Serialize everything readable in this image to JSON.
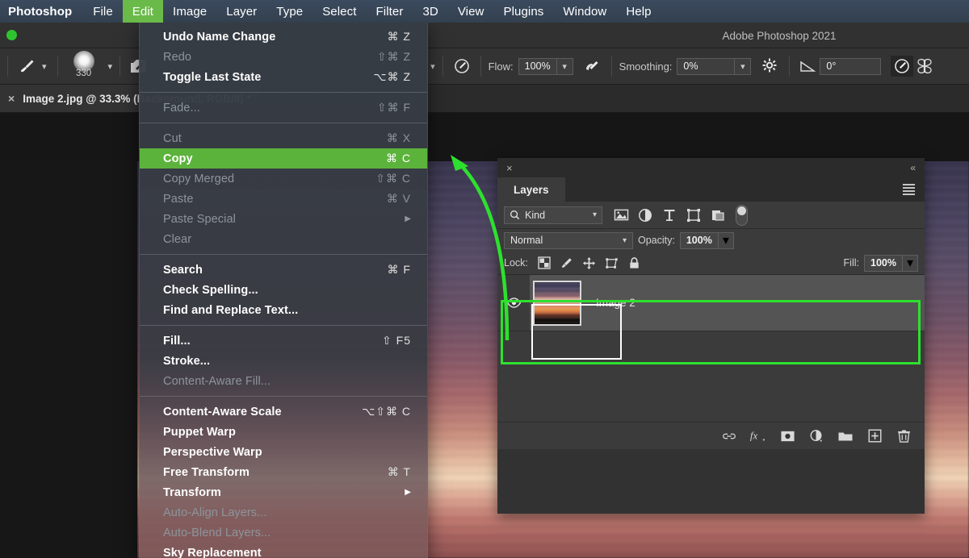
{
  "app": {
    "window_title": "Adobe Photoshop 2021",
    "accent_green": "#5cb33c",
    "annotation_green": "#2ee02e"
  },
  "menubar": {
    "items": [
      {
        "label": "Photoshop",
        "active": false,
        "bold": true
      },
      {
        "label": "File",
        "active": false
      },
      {
        "label": "Edit",
        "active": true
      },
      {
        "label": "Image",
        "active": false
      },
      {
        "label": "Layer",
        "active": false
      },
      {
        "label": "Type",
        "active": false
      },
      {
        "label": "Select",
        "active": false
      },
      {
        "label": "Filter",
        "active": false
      },
      {
        "label": "3D",
        "active": false
      },
      {
        "label": "View",
        "active": false
      },
      {
        "label": "Plugins",
        "active": false
      },
      {
        "label": "Window",
        "active": false
      },
      {
        "label": "Help",
        "active": false
      }
    ]
  },
  "toolbar": {
    "brush_size": "330",
    "flow_label": "Flow:",
    "flow_value": "100%",
    "smoothing_label": "Smoothing:",
    "smoothing_value": "0%",
    "angle_value": "0°"
  },
  "document_tab": {
    "title": "Image 2.jpg @ 33.3% (Background, RGB/8) *",
    "close_glyph": "×"
  },
  "edit_menu": {
    "groups": [
      {
        "items": [
          {
            "label": "Undo Name Change",
            "shortcut": "⌘ Z",
            "disabled": false,
            "highlight": false,
            "submenu": false
          },
          {
            "label": "Redo",
            "shortcut": "⇧⌘ Z",
            "disabled": true,
            "highlight": false,
            "submenu": false
          },
          {
            "label": "Toggle Last State",
            "shortcut": "⌥⌘ Z",
            "disabled": false,
            "highlight": false,
            "submenu": false
          }
        ]
      },
      {
        "items": [
          {
            "label": "Fade...",
            "shortcut": "⇧⌘ F",
            "disabled": true,
            "highlight": false,
            "submenu": false
          }
        ]
      },
      {
        "items": [
          {
            "label": "Cut",
            "shortcut": "⌘ X",
            "disabled": true,
            "highlight": false,
            "submenu": false
          },
          {
            "label": "Copy",
            "shortcut": "⌘ C",
            "disabled": false,
            "highlight": true,
            "submenu": false
          },
          {
            "label": "Copy Merged",
            "shortcut": "⇧⌘ C",
            "disabled": true,
            "highlight": false,
            "submenu": false
          },
          {
            "label": "Paste",
            "shortcut": "⌘ V",
            "disabled": true,
            "highlight": false,
            "submenu": false
          },
          {
            "label": "Paste Special",
            "shortcut": "",
            "disabled": true,
            "highlight": false,
            "submenu": true
          },
          {
            "label": "Clear",
            "shortcut": "",
            "disabled": true,
            "highlight": false,
            "submenu": false
          }
        ]
      },
      {
        "items": [
          {
            "label": "Search",
            "shortcut": "⌘ F",
            "disabled": false,
            "highlight": false,
            "submenu": false
          },
          {
            "label": "Check Spelling...",
            "shortcut": "",
            "disabled": false,
            "highlight": false,
            "submenu": false
          },
          {
            "label": "Find and Replace Text...",
            "shortcut": "",
            "disabled": false,
            "highlight": false,
            "submenu": false
          }
        ]
      },
      {
        "items": [
          {
            "label": "Fill...",
            "shortcut": "⇧ F5",
            "disabled": false,
            "highlight": false,
            "submenu": false
          },
          {
            "label": "Stroke...",
            "shortcut": "",
            "disabled": false,
            "highlight": false,
            "submenu": false
          },
          {
            "label": "Content-Aware Fill...",
            "shortcut": "",
            "disabled": true,
            "highlight": false,
            "submenu": false
          }
        ]
      },
      {
        "items": [
          {
            "label": "Content-Aware Scale",
            "shortcut": "⌥⇧⌘ C",
            "disabled": false,
            "highlight": false,
            "submenu": false
          },
          {
            "label": "Puppet Warp",
            "shortcut": "",
            "disabled": false,
            "highlight": false,
            "submenu": false
          },
          {
            "label": "Perspective Warp",
            "shortcut": "",
            "disabled": false,
            "highlight": false,
            "submenu": false
          },
          {
            "label": "Free Transform",
            "shortcut": "⌘ T",
            "disabled": false,
            "highlight": false,
            "submenu": false
          },
          {
            "label": "Transform",
            "shortcut": "",
            "disabled": false,
            "highlight": false,
            "submenu": true
          },
          {
            "label": "Auto-Align Layers...",
            "shortcut": "",
            "disabled": true,
            "highlight": false,
            "submenu": false
          },
          {
            "label": "Auto-Blend Layers...",
            "shortcut": "",
            "disabled": true,
            "highlight": false,
            "submenu": false
          },
          {
            "label": "Sky Replacement",
            "shortcut": "",
            "disabled": false,
            "highlight": false,
            "submenu": false
          }
        ]
      }
    ]
  },
  "layers_panel": {
    "tab_label": "Layers",
    "close_glyph": "×",
    "collapse_glyph": "«",
    "filter": {
      "kind_label": "Kind"
    },
    "blend": {
      "mode": "Normal",
      "opacity_label": "Opacity:",
      "opacity_value": "100%"
    },
    "lock": {
      "label": "Lock:",
      "fill_label": "Fill:",
      "fill_value": "100%"
    },
    "layers": [
      {
        "name": "Image 2",
        "visible": true,
        "selected": true
      }
    ]
  }
}
